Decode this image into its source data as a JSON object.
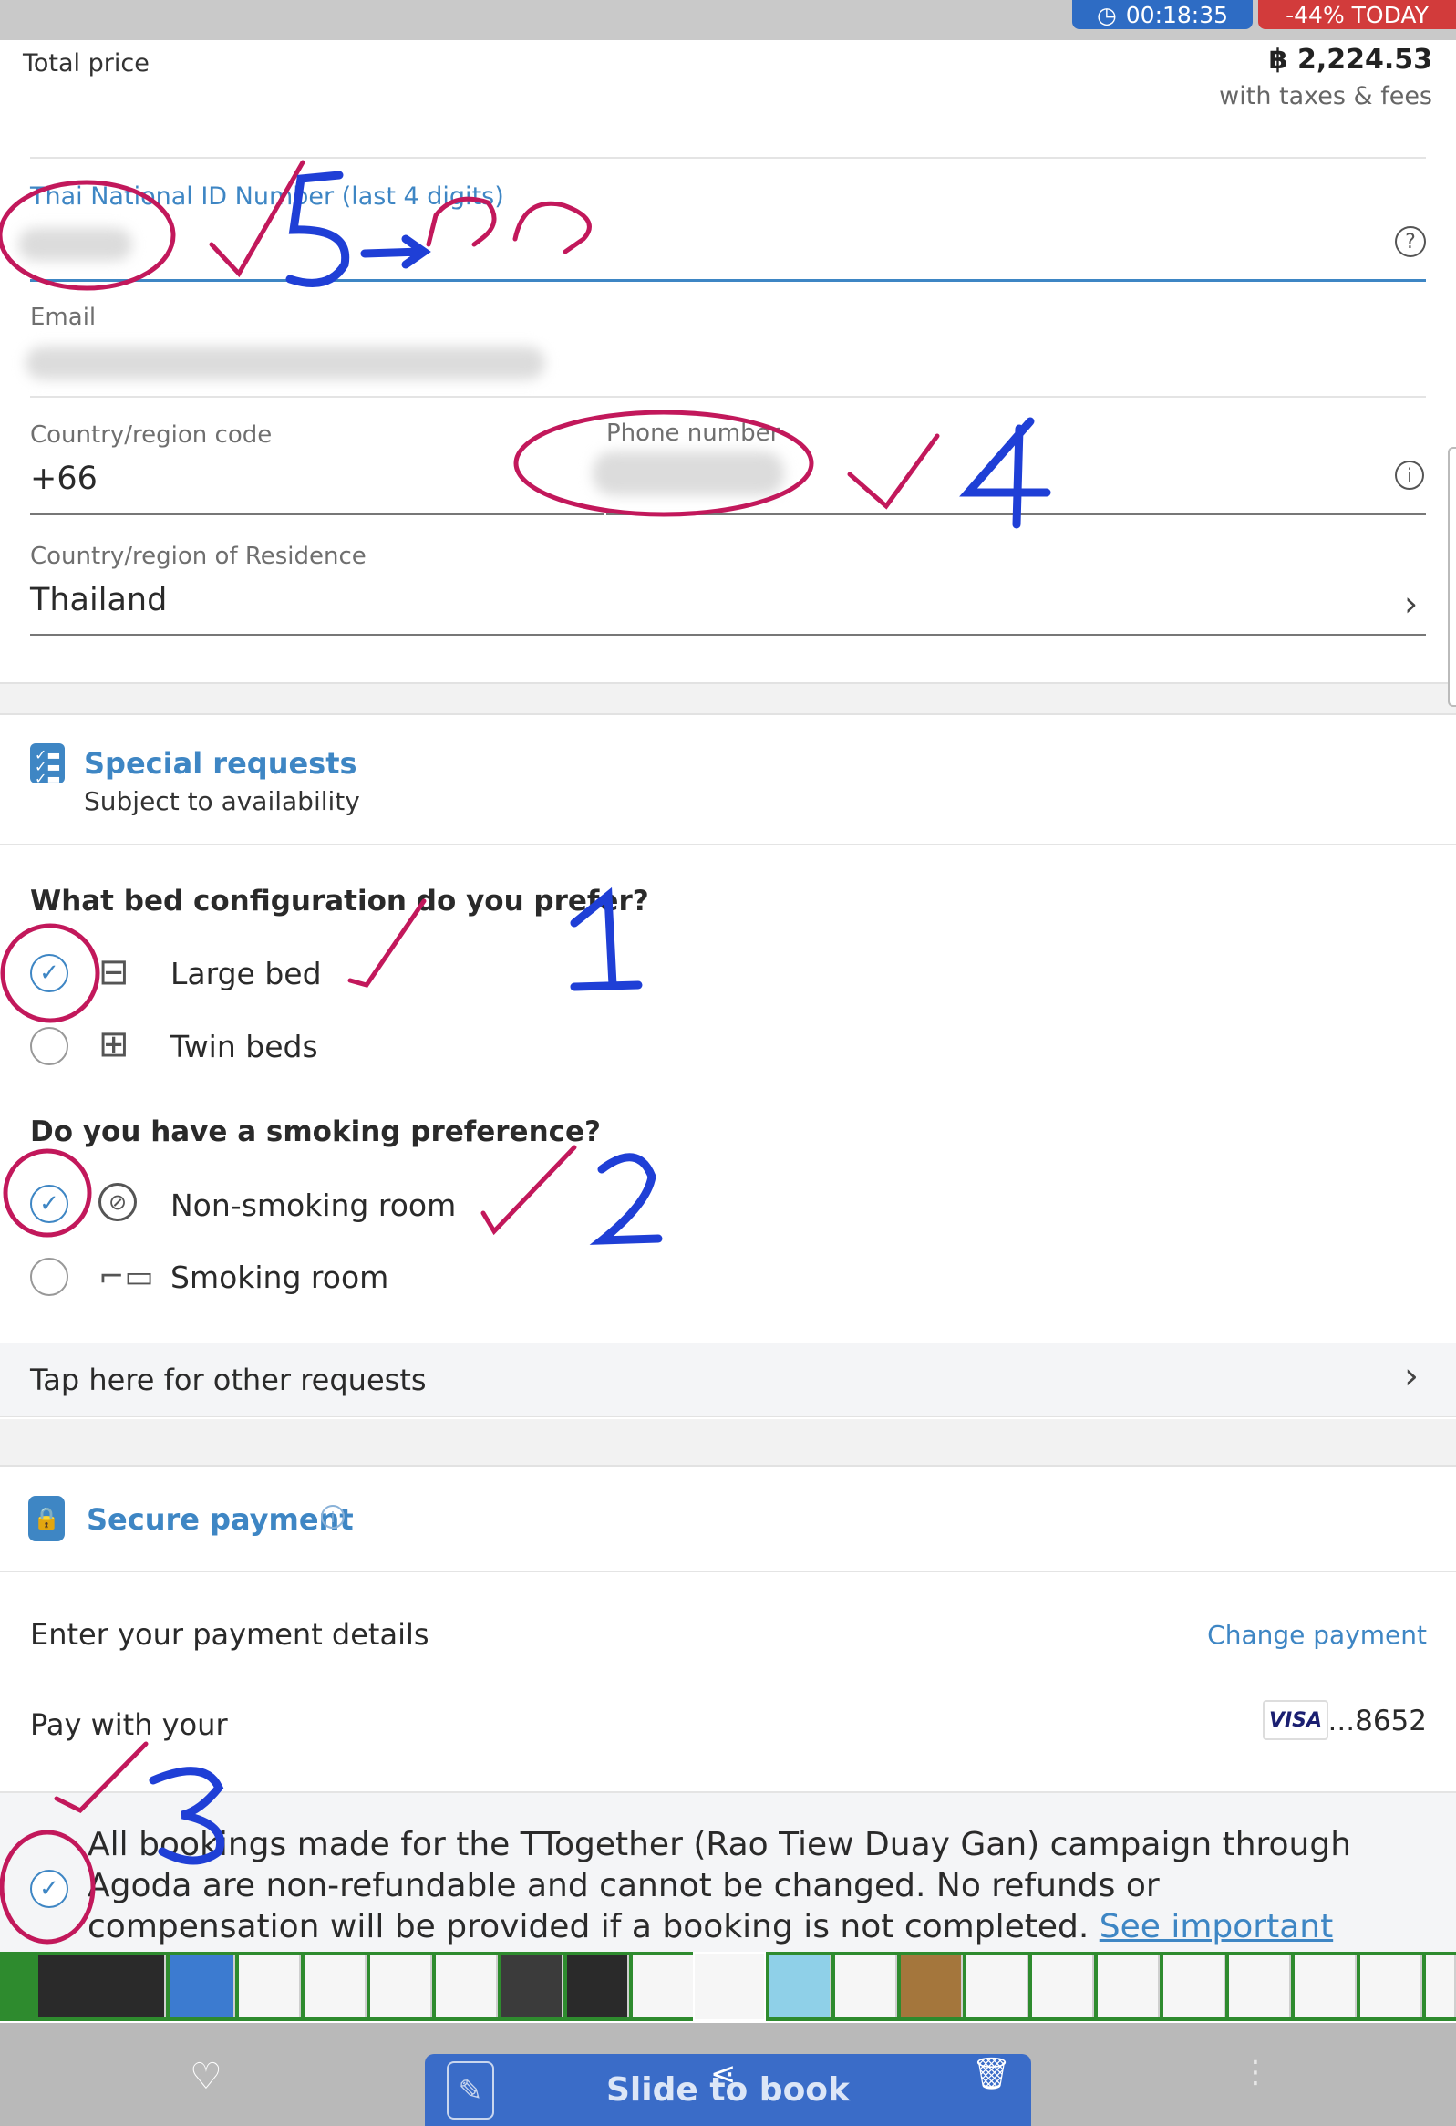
{
  "timer": {
    "icon": "clock-icon",
    "value": "00:18:35"
  },
  "promo": "-44% TODAY",
  "total": {
    "label": "Total price",
    "price": "฿ 2,224.53",
    "sub": "with taxes & fees"
  },
  "form": {
    "national_id_label": "Thai National ID Number (last 4 digits)",
    "email_label": "Email",
    "country_code_label": "Country/region code",
    "country_code_value": "+66",
    "phone_label": "Phone number",
    "residence_label": "Country/region of Residence",
    "residence_value": "Thailand"
  },
  "special": {
    "title": "Special requests",
    "subtitle": "Subject to availability"
  },
  "bed": {
    "question": "What bed configuration do you prefer?",
    "options": [
      {
        "label": "Large bed",
        "selected": true
      },
      {
        "label": "Twin beds",
        "selected": false
      }
    ]
  },
  "smoking": {
    "question": "Do you have a smoking preference?",
    "options": [
      {
        "label": "Non-smoking room",
        "selected": true
      },
      {
        "label": "Smoking room",
        "selected": false
      }
    ]
  },
  "other_requests": "Tap here for other requests",
  "payment": {
    "title": "Secure payment",
    "enter_label": "Enter your payment details",
    "change_label": "Change payment",
    "pay_label": "Pay with your",
    "card_brand": "VISA",
    "card_last4": "...8652"
  },
  "terms": {
    "text": "All bookings made for the TTogether (Rao Tiew Duay Gan) campaign through Agoda are non-refundable and cannot be changed. No refunds or compensation will be provided if a booking is not completed. ",
    "link": "See important details"
  },
  "slide_button": "Slide to book",
  "annotations": {
    "n1": "1",
    "n2": "2",
    "n3": "3",
    "n4": "4",
    "n5": "5",
    "thai": "รูด"
  },
  "colors": {
    "accent": "#3e86c4",
    "timer": "#2e6cc4",
    "promo": "#d23b3b",
    "ink_red": "#c2185b",
    "ink_blue": "#1f3fd6",
    "film": "#2e8b2e"
  }
}
